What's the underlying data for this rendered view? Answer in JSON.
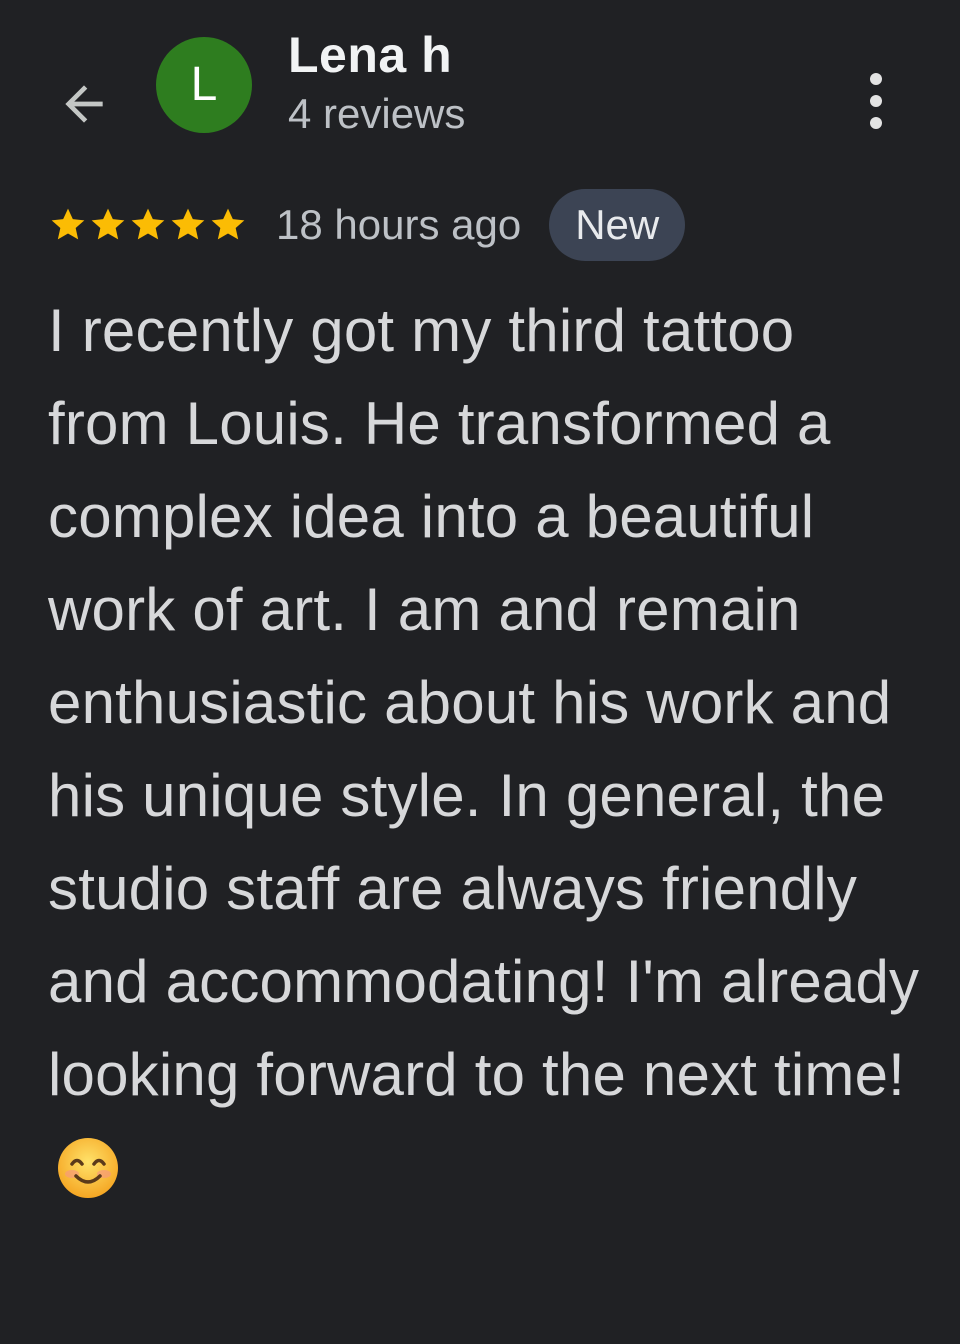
{
  "header": {
    "back_icon": "arrow-back-icon",
    "avatar_letter": "L",
    "avatar_color": "#2e7d1f",
    "reviewer_name": "Lena h",
    "review_count": "4 reviews",
    "more_icon": "more-vertical-icon"
  },
  "review": {
    "rating": 5,
    "rating_max": 5,
    "star_color": "#fbbc04",
    "time_ago": "18 hours ago",
    "badge": "New",
    "text": "I recently got my third tattoo from Louis. He transformed a complex idea into a beautiful work of art. I am and remain enthusiastic about his work and his unique style. In general, the studio staff are always friendly and accommodating! I'm already looking forward to the next time!",
    "emoji": "smiling-face-icon"
  }
}
